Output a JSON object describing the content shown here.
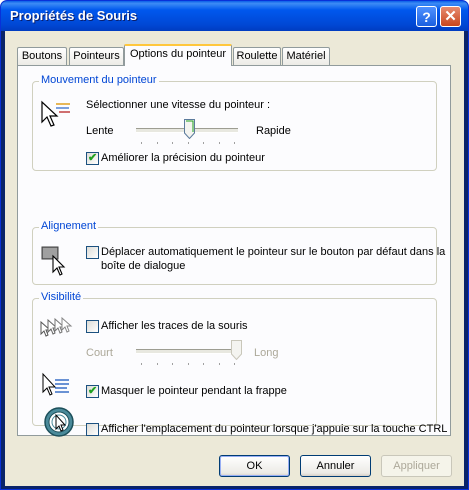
{
  "window": {
    "title": "Propriétés de Souris"
  },
  "tabs": [
    "Boutons",
    "Pointeurs",
    "Options du pointeur",
    "Roulette",
    "Matériel"
  ],
  "motion": {
    "label": "Mouvement du pointeur",
    "speed_label": "Sélectionner une vitesse du pointeur :",
    "slow": "Lente",
    "fast": "Rapide",
    "speed_value": 0.5,
    "precision_label": "Améliorer la précision du pointeur",
    "precision_checked": true
  },
  "snap": {
    "label": "Alignement",
    "snap_text_1": "Déplacer automatiquement le pointeur sur le bouton par défaut dans la",
    "snap_text_2": "boîte de dialogue",
    "snap_checked": false
  },
  "visibility": {
    "label": "Visibilité",
    "trails_label": "Afficher les traces de la souris",
    "trails_checked": false,
    "short": "Court",
    "long": "Long",
    "trails_value": 1.0,
    "hide_label": "Masquer le pointeur pendant la frappe",
    "hide_checked": true,
    "ctrl_label": "Afficher l'emplacement du pointeur lorsque j'appuie sur la touche CTRL",
    "ctrl_checked": false
  },
  "buttons": {
    "ok": "OK",
    "cancel": "Annuler",
    "apply": "Appliquer"
  },
  "icons": [
    "help-icon",
    "close-icon",
    "pointer-speed-icon",
    "snap-to-icon",
    "pointer-trails-icon",
    "hide-pointer-icon",
    "pointer-location-icon"
  ]
}
